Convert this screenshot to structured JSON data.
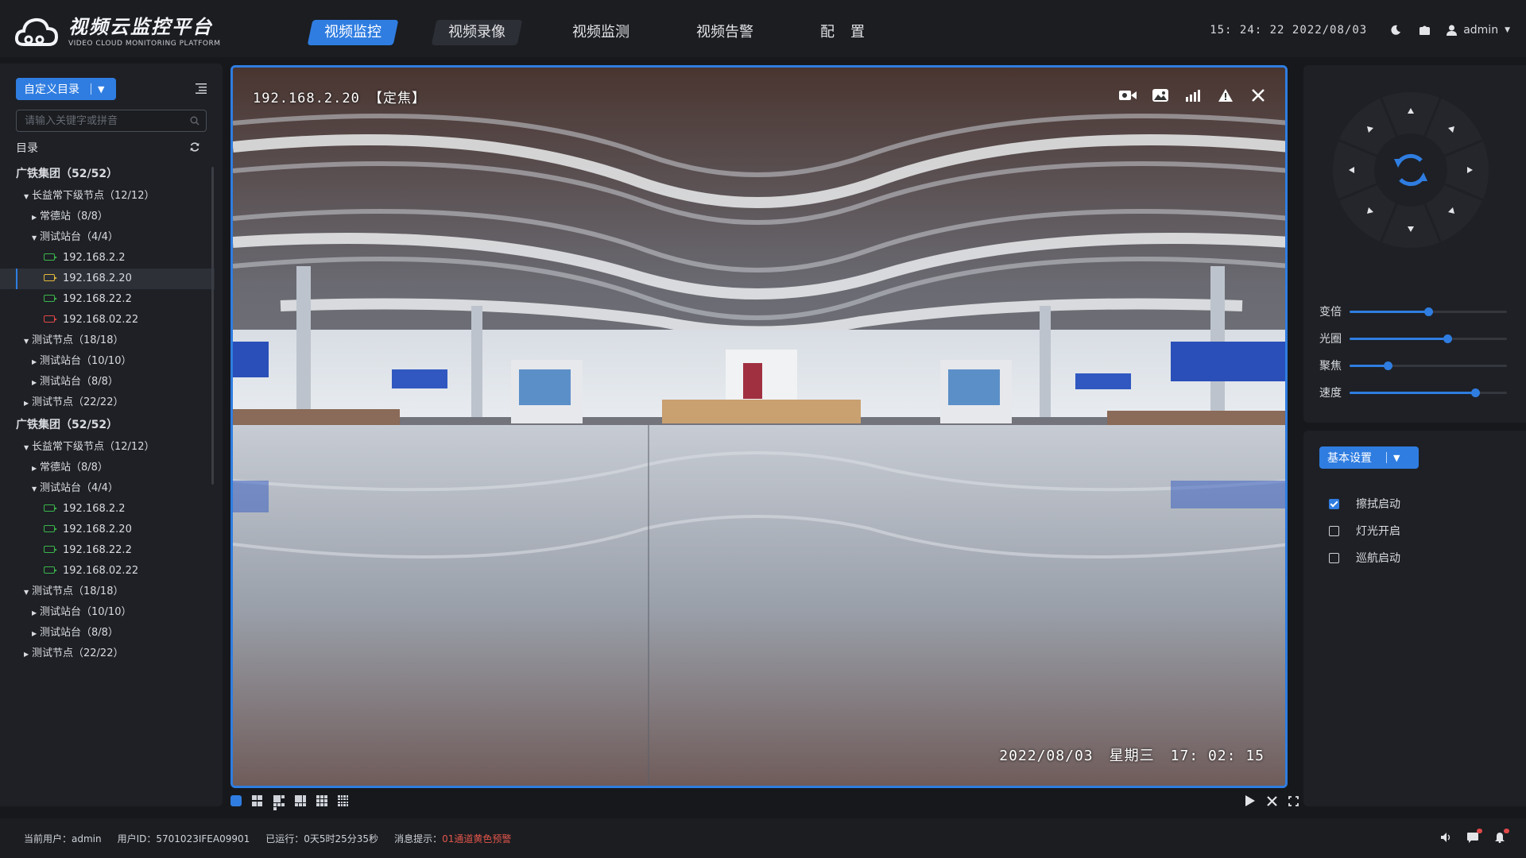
{
  "app": {
    "title": "视频云监控平台",
    "subtitle": "VIDEO CLOUD MONITORING PLATFORM"
  },
  "nav": [
    {
      "label": "视频监控",
      "active": true
    },
    {
      "label": "视频录像",
      "active": false
    },
    {
      "label": "视频监测",
      "active": false
    },
    {
      "label": "视频告警",
      "active": false
    },
    {
      "label": "配置",
      "active": false
    }
  ],
  "header": {
    "clock": "15: 24: 22  2022/08/03",
    "user": "admin"
  },
  "sidebar": {
    "dir_button": "自定义目录",
    "search_placeholder": "请输入关键字或拼音",
    "catalog_label": "目录",
    "tree": [
      {
        "label": "广铁集团（52/52）",
        "level": 0,
        "type": "group"
      },
      {
        "label": "长益常下级节点（12/12）",
        "level": 1,
        "type": "node",
        "expanded": true
      },
      {
        "label": "常德站（8/8）",
        "level": 2,
        "type": "node",
        "expanded": false
      },
      {
        "label": "测试站台（4/4）",
        "level": 2,
        "type": "node",
        "expanded": true
      },
      {
        "label": "192.168.2.2",
        "level": 3,
        "type": "cam",
        "status": "green"
      },
      {
        "label": "192.168.2.20",
        "level": 3,
        "type": "cam",
        "status": "yellow",
        "selected": true
      },
      {
        "label": "192.168.22.2",
        "level": 3,
        "type": "cam",
        "status": "green"
      },
      {
        "label": "192.168.02.22",
        "level": 3,
        "type": "cam",
        "status": "red"
      },
      {
        "label": "测试节点（18/18）",
        "level": 1,
        "type": "node",
        "expanded": true
      },
      {
        "label": "测试站台（10/10）",
        "level": 2,
        "type": "node",
        "expanded": false
      },
      {
        "label": "测试站台（8/8）",
        "level": 2,
        "type": "node",
        "expanded": false
      },
      {
        "label": "测试节点（22/22）",
        "level": 1,
        "type": "node",
        "expanded": false
      },
      {
        "label": "广铁集团（52/52）",
        "level": 0,
        "type": "group"
      },
      {
        "label": "长益常下级节点（12/12）",
        "level": 1,
        "type": "node",
        "expanded": true
      },
      {
        "label": "常德站（8/8）",
        "level": 2,
        "type": "node",
        "expanded": false
      },
      {
        "label": "测试站台（4/4）",
        "level": 2,
        "type": "node",
        "expanded": true
      },
      {
        "label": "192.168.2.2",
        "level": 3,
        "type": "cam",
        "status": "green"
      },
      {
        "label": "192.168.2.20",
        "level": 3,
        "type": "cam",
        "status": "green"
      },
      {
        "label": "192.168.22.2",
        "level": 3,
        "type": "cam",
        "status": "green"
      },
      {
        "label": "192.168.02.22",
        "level": 3,
        "type": "cam",
        "status": "green"
      },
      {
        "label": "测试节点（18/18）",
        "level": 1,
        "type": "node",
        "expanded": true
      },
      {
        "label": "测试站台（10/10）",
        "level": 2,
        "type": "node",
        "expanded": false
      },
      {
        "label": "测试站台（8/8）",
        "level": 2,
        "type": "node",
        "expanded": false
      },
      {
        "label": "测试节点（22/22）",
        "level": 1,
        "type": "node",
        "expanded": false
      }
    ]
  },
  "video": {
    "title": "192.168.2.20 【定焦】",
    "date": "2022/08/03",
    "weekday": "星期三",
    "time": "17: 02: 15",
    "tool_icons": [
      "video-camera-icon",
      "snapshot-icon",
      "signal-icon",
      "warning-icon",
      "close-icon"
    ]
  },
  "layout_options": [
    "1x1",
    "2x2",
    "1+5",
    "1+7",
    "3x3",
    "4x4"
  ],
  "ptz": {
    "sliders": [
      {
        "label": "变倍",
        "value": 0.5
      },
      {
        "label": "光圈",
        "value": 0.62
      },
      {
        "label": "聚焦",
        "value": 0.24
      },
      {
        "label": "速度",
        "value": 0.8
      }
    ]
  },
  "settings": {
    "button": "基本设置",
    "options": [
      {
        "label": "擦拭启动",
        "checked": true
      },
      {
        "label": "灯光开启",
        "checked": false
      },
      {
        "label": "巡航启动",
        "checked": false
      }
    ]
  },
  "footer": {
    "current_user": "当前用户：admin",
    "user_id": "用户ID：5701023IFEA09901",
    "uptime": "已运行：0天5时25分35秒",
    "message_label": "消息提示：",
    "message": "01通道黄色预警"
  },
  "colors": {
    "accent": "#2f7de1",
    "status_green": "#3bb54a",
    "status_yellow": "#e2b93b",
    "status_red": "#e04848",
    "warn_text": "#e0554a"
  }
}
